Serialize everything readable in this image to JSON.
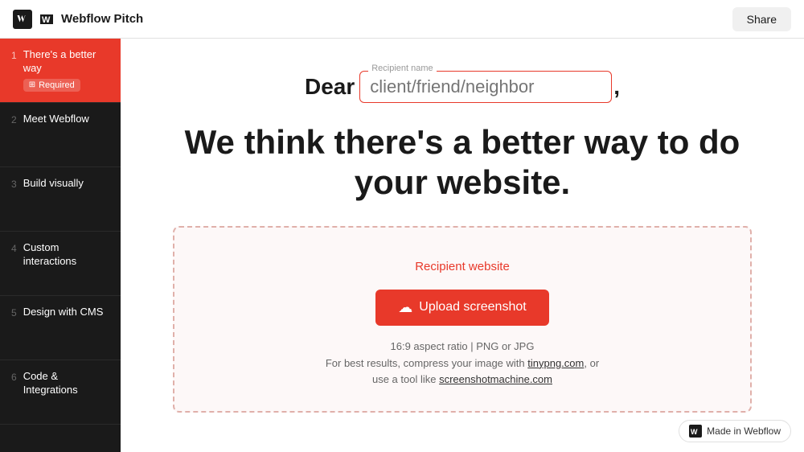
{
  "header": {
    "logo_text": "Webflow Pitch",
    "share_label": "Share"
  },
  "sidebar": {
    "items": [
      {
        "number": "1",
        "label": "There's a better way",
        "active": true,
        "required": true,
        "required_label": "Required"
      },
      {
        "number": "2",
        "label": "Meet Webflow",
        "active": false
      },
      {
        "number": "3",
        "label": "Build visually",
        "active": false
      },
      {
        "number": "4",
        "label": "Custom interactions",
        "active": false
      },
      {
        "number": "5",
        "label": "Design with CMS",
        "active": false
      },
      {
        "number": "6",
        "label": "Code & Integrations",
        "active": false
      }
    ]
  },
  "content": {
    "dear_text": "Dear",
    "comma": ",",
    "recipient_label": "Recipient name",
    "recipient_placeholder": "client/friend/neighbor",
    "heading_line1": "We think there's a better way to do",
    "heading_line2": "your website.",
    "upload_section": {
      "recipient_website_label": "Recipient website",
      "upload_button_label": "Upload screenshot",
      "aspect_ratio_info": "16:9 aspect ratio  |  PNG or JPG",
      "compress_info": "For best results, compress your image with",
      "tinypng_link": "tinypng.com",
      "or_text": ", or",
      "tool_text": "use a tool like",
      "screenshotmachine_link": "screenshotmachine.com"
    },
    "made_in_webflow": "Made in Webflow"
  }
}
